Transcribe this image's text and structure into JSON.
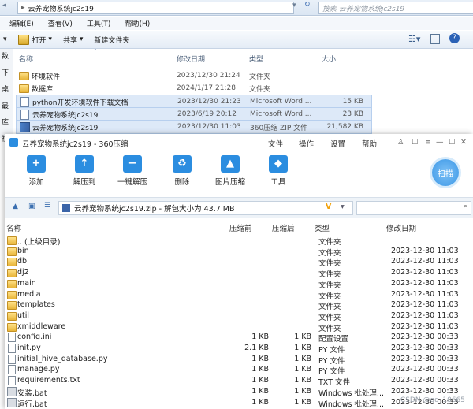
{
  "explorer": {
    "breadcrumb": "云养宠物系统jc2s19",
    "search_placeholder": "搜索 云养宠物系统jc2s19",
    "menu": [
      "编辑(E)",
      "查看(V)",
      "工具(T)",
      "帮助(H)"
    ],
    "toolbar": {
      "open": "打开",
      "share": "共享",
      "new_folder": "新建文件夹"
    },
    "left_labels": [
      "数",
      "下",
      "桌",
      "最",
      "库",
      "视"
    ],
    "columns": {
      "name": "名称",
      "date": "修改日期",
      "type": "类型",
      "size": "大小"
    },
    "rows": [
      {
        "icon": "folder",
        "name": "环境软件",
        "date": "2023/12/30 21:24",
        "type": "文件夹",
        "size": ""
      },
      {
        "icon": "folder",
        "name": "数据库",
        "date": "2024/1/17 21:28",
        "type": "文件夹",
        "size": ""
      },
      {
        "icon": "doc",
        "name": "python开发环境软件下载文档",
        "date": "2023/12/30 21:23",
        "type": "Microsoft Word ...",
        "size": "15 KB"
      },
      {
        "icon": "doc",
        "name": "云养宠物系统jc2s19",
        "date": "2023/6/19 20:12",
        "type": "Microsoft Word ...",
        "size": "23 KB"
      },
      {
        "icon": "zip",
        "name": "云养宠物系统jc2s19",
        "date": "2023/12/30 11:03",
        "type": "360压缩 ZIP 文件",
        "size": "21,582 KB"
      }
    ]
  },
  "zip": {
    "title": "云养宠物系统jc2s19 - 360压缩",
    "menu": [
      "文件",
      "操作",
      "设置",
      "帮助"
    ],
    "tools": [
      "添加",
      "解压到",
      "一键解压",
      "删除",
      "图片压缩",
      "工具"
    ],
    "scan_label": "扫描",
    "path": "云养宠物系统jc2s19.zip - 解包大小为 43.7 MB",
    "columns": {
      "name": "名称",
      "before": "压缩前",
      "after": "压缩后",
      "type": "类型",
      "date": "修改日期"
    },
    "rows": [
      {
        "icon": "folder",
        "name": ".. (上级目录)",
        "before": "",
        "after": "",
        "type": "文件夹",
        "date": ""
      },
      {
        "icon": "folder",
        "name": "bin",
        "before": "",
        "after": "",
        "type": "文件夹",
        "date": "2023-12-30 11:03"
      },
      {
        "icon": "folder",
        "name": "db",
        "before": "",
        "after": "",
        "type": "文件夹",
        "date": "2023-12-30 11:03"
      },
      {
        "icon": "folder",
        "name": "dj2",
        "before": "",
        "after": "",
        "type": "文件夹",
        "date": "2023-12-30 11:03"
      },
      {
        "icon": "folder",
        "name": "main",
        "before": "",
        "after": "",
        "type": "文件夹",
        "date": "2023-12-30 11:03"
      },
      {
        "icon": "folder",
        "name": "media",
        "before": "",
        "after": "",
        "type": "文件夹",
        "date": "2023-12-30 11:03"
      },
      {
        "icon": "folder",
        "name": "templates",
        "before": "",
        "after": "",
        "type": "文件夹",
        "date": "2023-12-30 11:03"
      },
      {
        "icon": "folder",
        "name": "util",
        "before": "",
        "after": "",
        "type": "文件夹",
        "date": "2023-12-30 11:03"
      },
      {
        "icon": "folder",
        "name": "xmiddleware",
        "before": "",
        "after": "",
        "type": "文件夹",
        "date": "2023-12-30 11:03"
      },
      {
        "icon": "doc",
        "name": "config.ini",
        "before": "1 KB",
        "after": "1 KB",
        "type": "配置设置",
        "date": "2023-12-30 00:33"
      },
      {
        "icon": "doc",
        "name": "init.py",
        "before": "2.1 KB",
        "after": "1 KB",
        "type": "PY 文件",
        "date": "2023-12-30 00:33"
      },
      {
        "icon": "doc",
        "name": "initial_hive_database.py",
        "before": "1 KB",
        "after": "1 KB",
        "type": "PY 文件",
        "date": "2023-12-30 00:33"
      },
      {
        "icon": "doc",
        "name": "manage.py",
        "before": "1 KB",
        "after": "1 KB",
        "type": "PY 文件",
        "date": "2023-12-30 00:33"
      },
      {
        "icon": "doc",
        "name": "requirements.txt",
        "before": "1 KB",
        "after": "1 KB",
        "type": "TXT 文件",
        "date": "2023-12-30 00:33"
      },
      {
        "icon": "bat",
        "name": "安装.bat",
        "before": "1 KB",
        "after": "1 KB",
        "type": "Windows 批处理...",
        "date": "2023-12-30 00:33"
      },
      {
        "icon": "bat",
        "name": "运行.bat",
        "before": "1 KB",
        "after": "1 KB",
        "type": "Windows 批处理...",
        "date": "2023-12-30 00:33"
      }
    ],
    "watermark": "CSDN @qq_10665"
  }
}
